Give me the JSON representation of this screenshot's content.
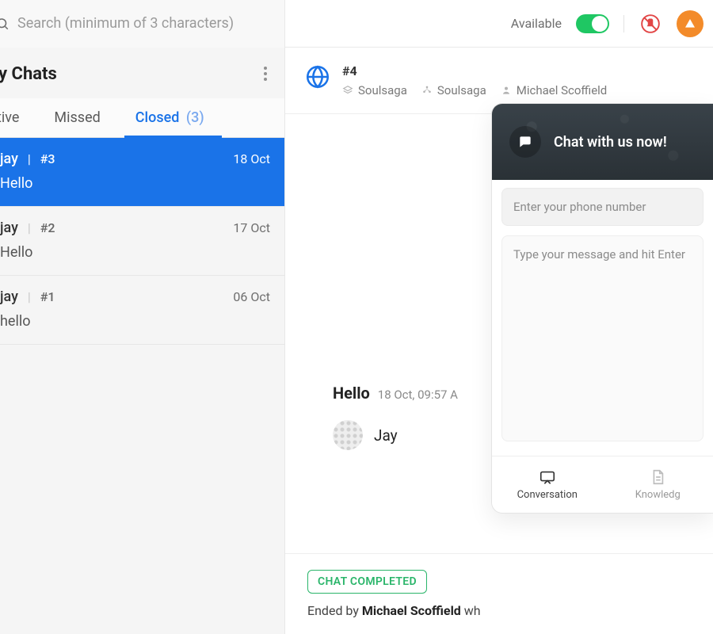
{
  "search": {
    "placeholder": "Search (minimum of 3 characters)"
  },
  "top": {
    "available_label": "Available",
    "available_on": true
  },
  "sidebar": {
    "title": "y Chats",
    "tabs": [
      {
        "label": "tive",
        "count": null,
        "active": false
      },
      {
        "label": "Missed",
        "count": null,
        "active": false
      },
      {
        "label": "Closed",
        "count": "(3)",
        "active": true
      }
    ]
  },
  "chats": [
    {
      "name": "jay",
      "id": "#3",
      "date": "18 Oct",
      "preview": "Hello",
      "selected": true
    },
    {
      "name": "jay",
      "id": "#2",
      "date": "17 Oct",
      "preview": "Hello",
      "selected": false
    },
    {
      "name": "jay",
      "id": "#1",
      "date": "06 Oct",
      "preview": "hello",
      "selected": false
    }
  ],
  "conversation": {
    "id": "#4",
    "portal": "Soulsaga",
    "department": "Soulsaga",
    "visitor": "Michael Scoffield",
    "message": {
      "text": "Hello",
      "time": "18 Oct, 09:57 A"
    },
    "sender": "Jay",
    "status_chip": "CHAT COMPLETED",
    "ended_prefix": "Ended by ",
    "ended_by": "Michael Scoffield",
    "ended_suffix": " wh"
  },
  "widget": {
    "title": "Chat with us now!",
    "phone_placeholder": "Enter your phone number",
    "message_placeholder": "Type your message and hit Enter",
    "tabs": {
      "conversation": "Conversation",
      "knowledge": "Knowledg"
    }
  }
}
